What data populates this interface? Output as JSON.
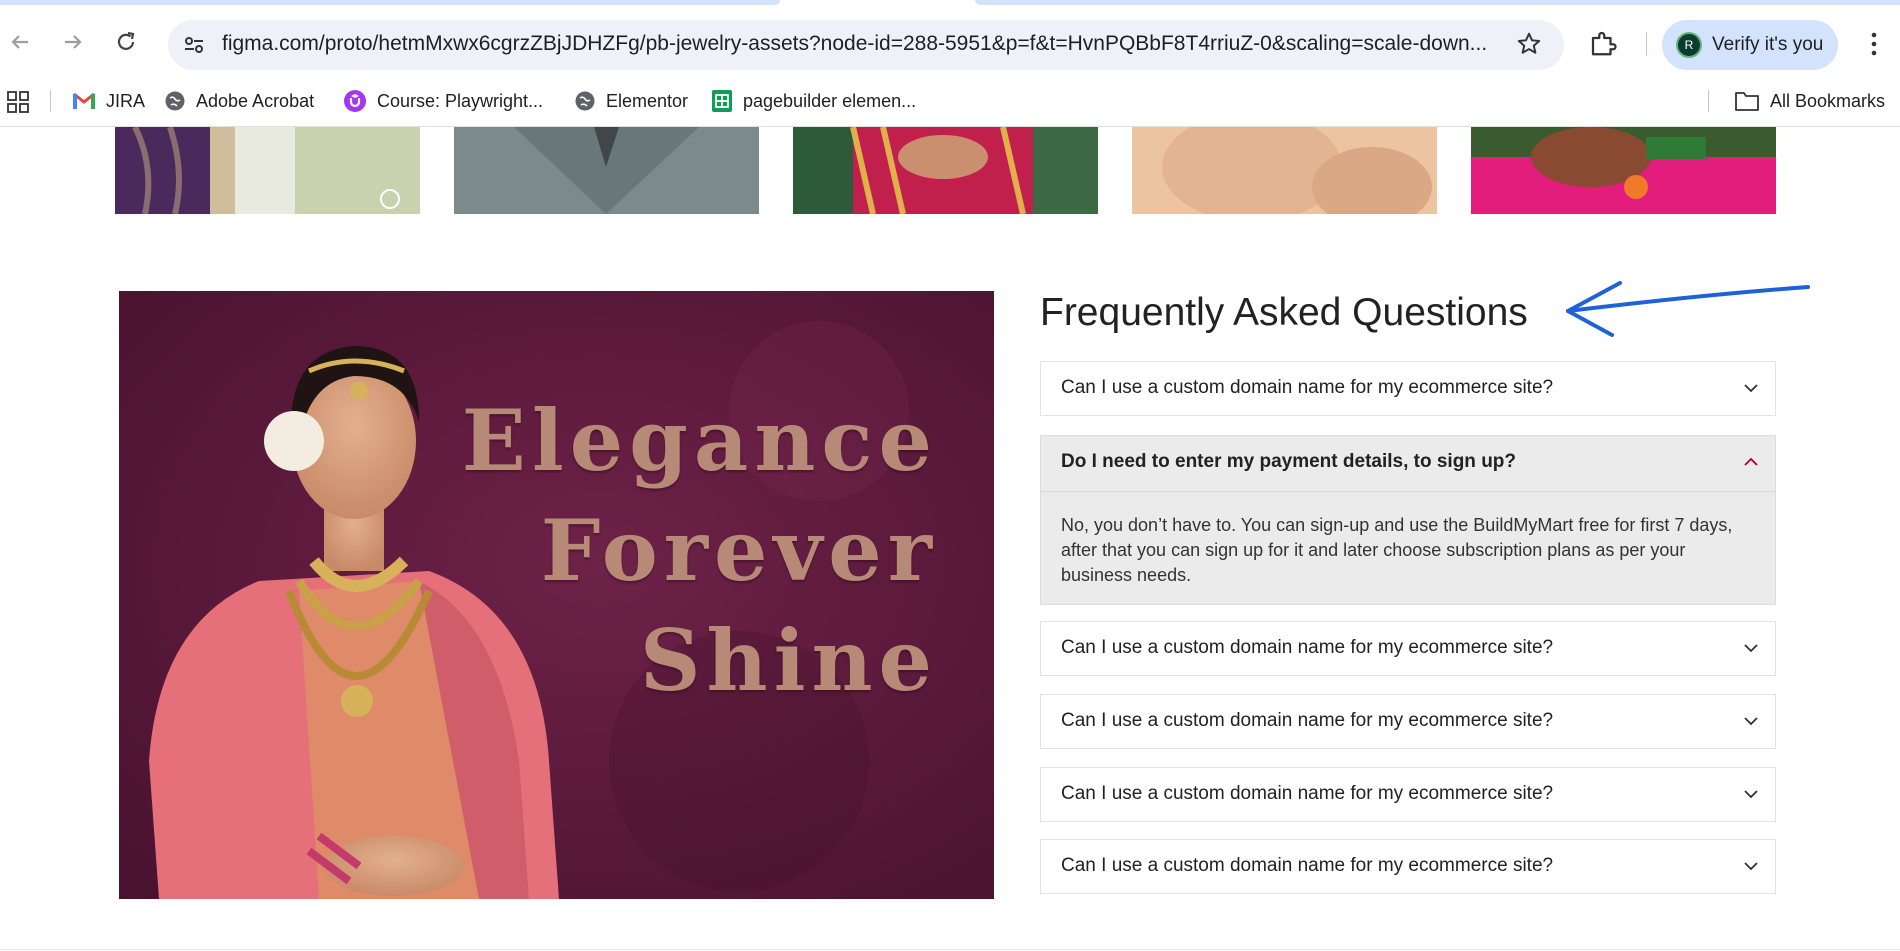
{
  "browser": {
    "url": "figma.com/proto/hetmMxwx6cgrzZBjJDHZFg/pb-jewelry-assets?node-id=288-5951&p=f&t=HvnPQBbF8T4rriuZ-0&scaling=scale-down...",
    "profile_initial": "R",
    "verify_label": "Verify it's you"
  },
  "bookmarks": {
    "items": [
      {
        "label": "JIRA",
        "icon": "gmail-icon"
      },
      {
        "label": "Adobe Acrobat",
        "icon": "globe-icon"
      },
      {
        "label": "Course: Playwright...",
        "icon": "udemy-icon"
      },
      {
        "label": "Elementor",
        "icon": "globe-icon"
      },
      {
        "label": "pagebuilder elemen...",
        "icon": "sheets-icon"
      }
    ],
    "all_label": "All Bookmarks"
  },
  "hero": {
    "lines": [
      "Elegance",
      "Forever",
      "Shine"
    ]
  },
  "faq": {
    "title": "Frequently Asked Questions",
    "items": [
      {
        "question": "Can I use a custom domain name for my ecommerce site?",
        "open": false
      },
      {
        "question": "Do I need to enter my payment details, to sign up?",
        "open": true,
        "answer": "No, you don’t have to. You can sign-up and use the BuildMyMart free for first 7 days, after that you can  sign up for it and later choose subscription plans as per your business needs."
      },
      {
        "question": "Can I use a custom domain name for my ecommerce site?",
        "open": false
      },
      {
        "question": "Can I use a custom domain name for my ecommerce site?",
        "open": false
      },
      {
        "question": "Can I use a custom domain name for my ecommerce site?",
        "open": false
      },
      {
        "question": "Can I use a custom domain name for my ecommerce site?",
        "open": false
      }
    ]
  },
  "colors": {
    "accent": "#1f62d8",
    "hero_bg": "#5e1c3d",
    "hero_text": "#b78a78",
    "open_bg": "#ebebeb"
  }
}
